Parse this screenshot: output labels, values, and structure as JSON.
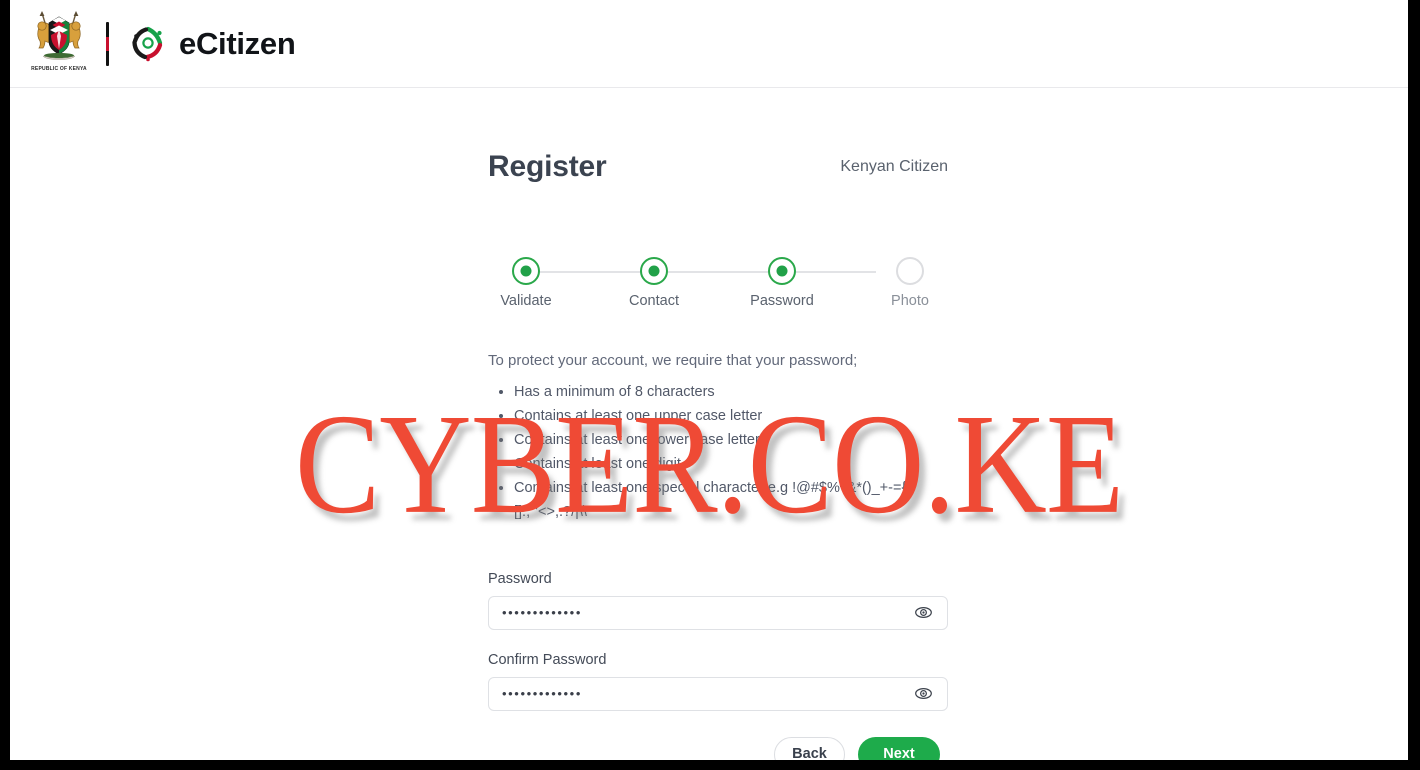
{
  "header": {
    "coat_of_arms_caption": "REPUBLIC OF KENYA",
    "brand_name": "eCitizen"
  },
  "form": {
    "title": "Register",
    "segment": "Kenyan Citizen",
    "steps": [
      {
        "label": "Validate",
        "state": "complete"
      },
      {
        "label": "Contact",
        "state": "complete"
      },
      {
        "label": "Password",
        "state": "current"
      },
      {
        "label": "Photo",
        "state": "upcoming"
      }
    ],
    "requirements_intro": "To protect your account, we require that your password;",
    "requirements": [
      "Has a minimum of 8 characters",
      "Contains at least one upper case letter",
      "Contains at least one lower case letter",
      "Contains at least one digit",
      "Contains at least one special character e.g !@#$%^&*()_+-={}[]:;\"'<>,.?/|\\\\"
    ],
    "password": {
      "label": "Password",
      "value": "•••••••••••••",
      "placeholder": "",
      "toggle_icon": "eye-icon"
    },
    "confirm_password": {
      "label": "Confirm Password",
      "value": "•••••••••••••",
      "placeholder": "",
      "toggle_icon": "eye-icon"
    },
    "buttons": {
      "back": "Back",
      "next": "Next"
    }
  },
  "watermark": {
    "text": "CYBER.CO.KE",
    "color": "#ef4a35"
  },
  "colors": {
    "accent_green": "#1eab4b",
    "step_green": "#21a148",
    "text_dark": "#3b4350",
    "text_muted": "#62697a",
    "border": "#dfe1e5",
    "watermark_red": "#ef4a35",
    "frame_black": "#000000"
  }
}
